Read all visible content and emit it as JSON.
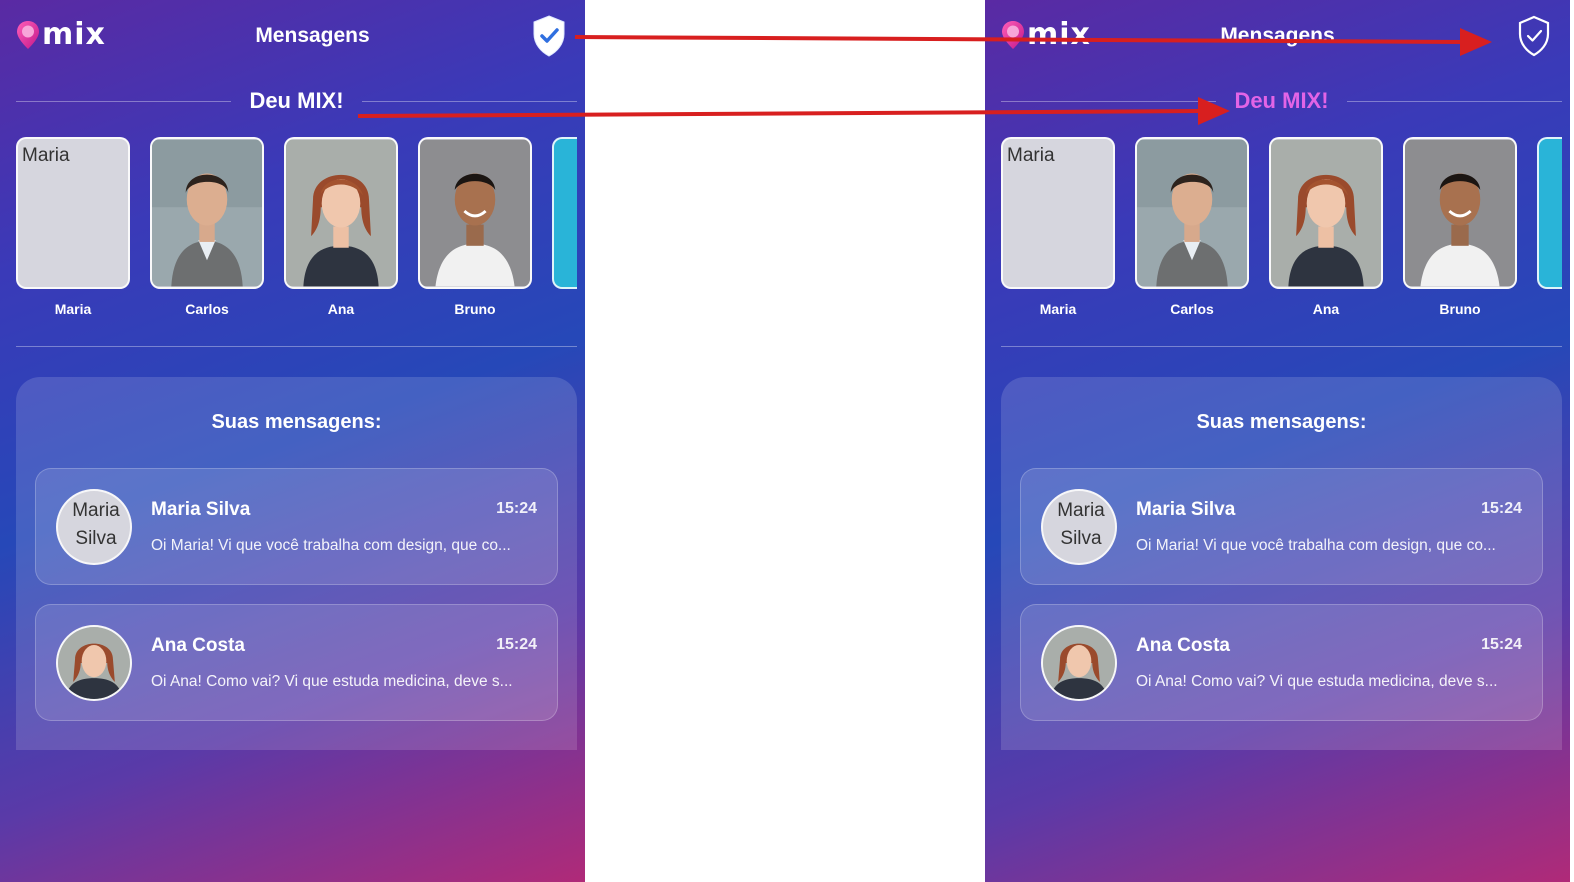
{
  "app": {
    "logo_text": "mix",
    "title": "Mensagens",
    "match_heading": "Deu MIX!",
    "messages_heading": "Suas mensagens:"
  },
  "matches": [
    {
      "name": "Maria",
      "alt": "Maria",
      "broken": true
    },
    {
      "name": "Carlos",
      "alt": "Carlos",
      "broken": false
    },
    {
      "name": "Ana",
      "alt": "Ana",
      "broken": false
    },
    {
      "name": "Bruno",
      "alt": "Bruno",
      "broken": false
    }
  ],
  "conversations": [
    {
      "name": "Maria Silva",
      "time": "15:24",
      "preview": "Oi Maria! Vi que você trabalha com design, que co...",
      "alt": "Maria Silva"
    },
    {
      "name": "Ana Costa",
      "time": "15:24",
      "preview": "Oi Ana! Como vai? Vi que estuda medicina, deve s...",
      "alt": "Ana Costa"
    }
  ],
  "colors": {
    "accent_pink": "#e264e6",
    "arrow_red": "#d81f1f"
  },
  "icons": [
    "logo-pin-icon",
    "shield-check-icon"
  ]
}
